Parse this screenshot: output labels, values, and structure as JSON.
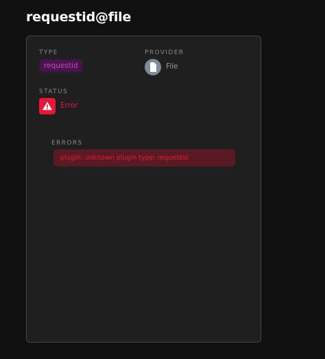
{
  "page": {
    "title": "requestid@file"
  },
  "details": {
    "type_label": "TYPE",
    "type_value": "requestid",
    "provider_label": "PROVIDER",
    "provider_name": "File",
    "provider_icon": "file-icon",
    "status_label": "STATUS",
    "status_value": "Error",
    "status_icon": "warning-icon",
    "errors_label": "ERRORS",
    "errors": [
      "plugin: unknown plugin type: requestid"
    ]
  },
  "colors": {
    "background": "#111112",
    "card": "#1f1f20",
    "error": "#e5193d",
    "badge_bg": "#4b1450",
    "badge_text": "#b453b8"
  }
}
